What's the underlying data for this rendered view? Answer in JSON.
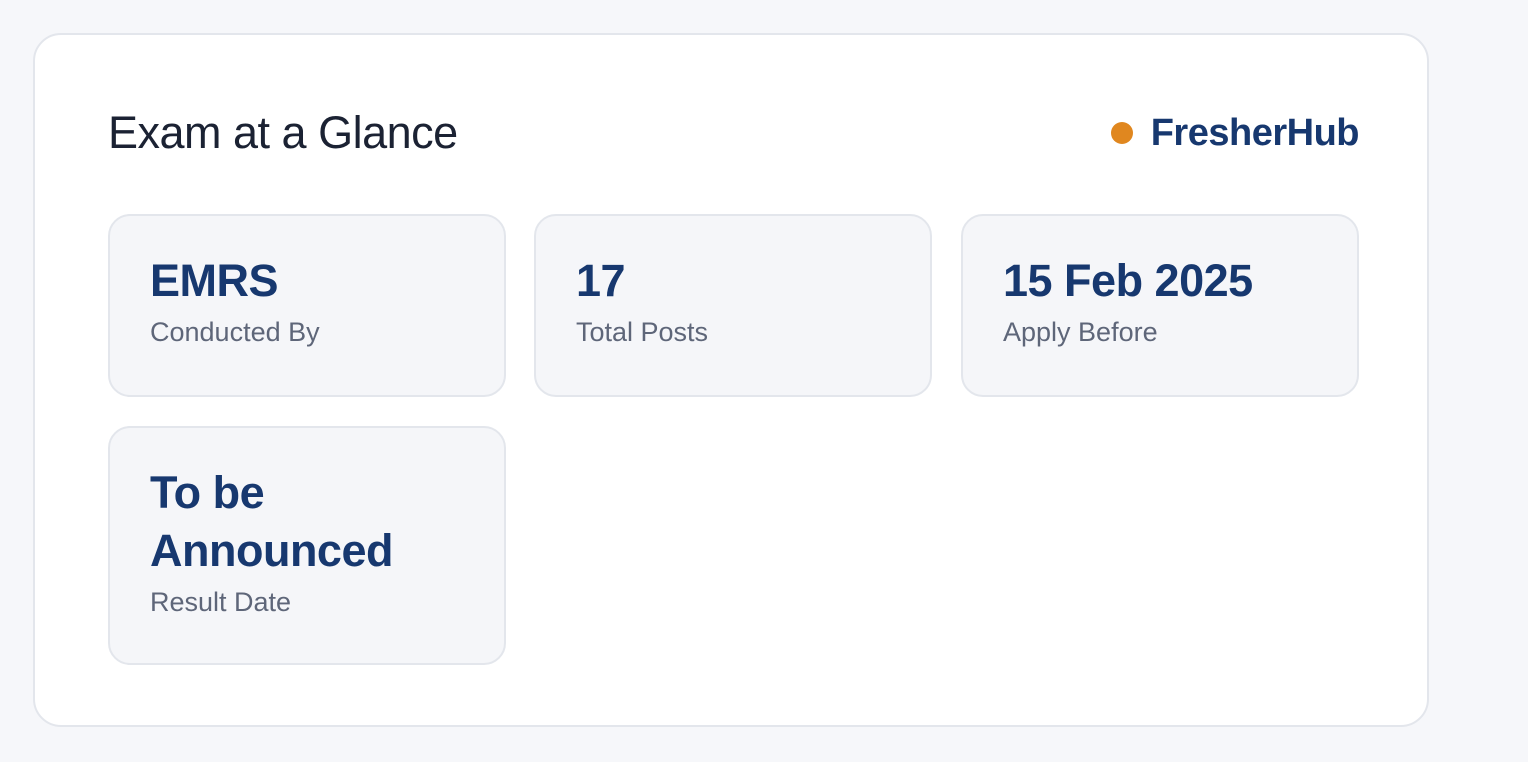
{
  "header": {
    "title": "Exam at a Glance",
    "brand": "FresherHub",
    "brand_dot_color": "#e0871f"
  },
  "tiles": [
    {
      "value": "EMRS",
      "label": "Conducted By"
    },
    {
      "value": "17",
      "label": "Total Posts"
    },
    {
      "value": "15 Feb 2025",
      "label": "Apply Before"
    },
    {
      "value": "To be Announced",
      "label": "Result Date"
    }
  ],
  "colors": {
    "accent": "#17386f",
    "title": "#1b2233",
    "label": "#5e6679",
    "tile_bg": "#f5f6f9",
    "page_bg": "#f6f7fa"
  }
}
